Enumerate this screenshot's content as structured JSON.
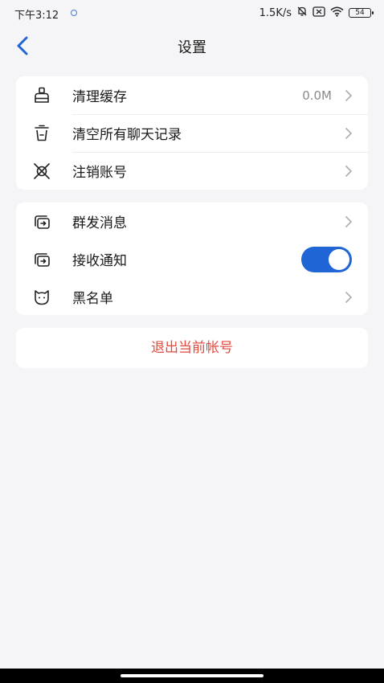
{
  "status_bar": {
    "time": "下午3:12",
    "net_speed": "1.5K/s",
    "battery": "54",
    "icons": [
      "mute-bell-icon",
      "no-sim-icon",
      "wifi-icon",
      "battery-icon"
    ]
  },
  "header": {
    "title": "设置",
    "back_icon": "chevron-left-icon"
  },
  "group1": {
    "items": [
      {
        "label": "清理缓存",
        "value": "0.0M",
        "icon": "broom-icon"
      },
      {
        "label": "清空所有聊天记录",
        "icon": "trash-icon"
      },
      {
        "label": "注销账号",
        "icon": "account-cancel-icon"
      }
    ]
  },
  "group2": {
    "items": [
      {
        "label": "群发消息",
        "icon": "broadcast-icon"
      },
      {
        "label": "接收通知",
        "icon": "notification-icon",
        "toggle_on": true
      },
      {
        "label": "黑名单",
        "icon": "blacklist-icon"
      }
    ]
  },
  "logout_label": "退出当前帐号",
  "colors": {
    "accent": "#1f65d6",
    "danger": "#e5483c",
    "background": "#f5f5f7"
  }
}
